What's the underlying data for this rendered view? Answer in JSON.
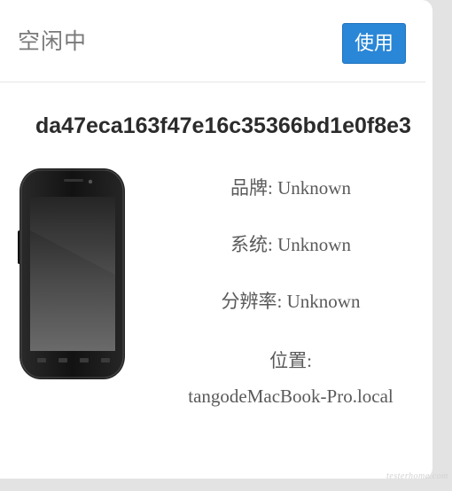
{
  "header": {
    "status": "空闲中",
    "use_button_label": "使用"
  },
  "device": {
    "id": "da47eca163f47e16c35366bd1e0f8e3",
    "brand_line": "品牌: Unknown",
    "system_line": "系统: Unknown",
    "resolution_line": "分辨率: Unknown",
    "location_label": "位置:",
    "location_value": "tangodeMacBook-Pro.local"
  },
  "watermark": "testerhome.com",
  "colors": {
    "accent": "#2a86d6",
    "status_text": "#7a7a7a",
    "page_background": "#e3e3e3"
  },
  "icons": {
    "phone": "phone-image"
  }
}
